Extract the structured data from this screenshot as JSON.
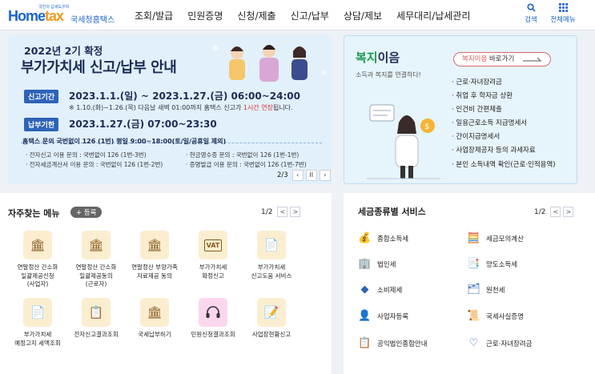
{
  "header": {
    "logo_small": "국민의 납세도우미",
    "logo_brand_a": "Home",
    "logo_brand_b": "tax",
    "logo_sub": "국세청홈택스",
    "nav": [
      "조회/발급",
      "민원증명",
      "신청/제출",
      "신고/납부",
      "상담/제보",
      "세무대리/납세관리"
    ],
    "search_label": "검색",
    "menu_label": "전체메뉴"
  },
  "banner": {
    "title1": "2022년 2기 확정",
    "title2": "부가가치세 신고/납부 안내",
    "period_pill": "신고기간",
    "period": "2023.1.1.(일) ~ 2023.1.27.(금) 06:00~24:00",
    "note_a": "※ 1.10.(화)~1.26.(목) 다음날 새벽 01:00까지 홈택스 신고가 ",
    "note_red": "1시간 연장",
    "note_b": "됩니다.",
    "deadline_pill": "납부기한",
    "deadline": "2023.1.27.(금) 07:00~23:30",
    "contact_main": "홈택스 문의 국번없이 126 (1번)  평일 9:00~18:00(토/일/공휴일 제외)",
    "contact_1": "· 전자신고 이용 문의 : 국번없이 126 (1번-3번)",
    "contact_2": "· 현금영수증 문의 : 국번없이 126 (1번-1번)",
    "contact_3": "· 전자세금계산서 이용 문의 : 국번없이 126 (1번-2번)",
    "contact_4": "· 증명발급 이용 문의 : 국번없이 126 (1번-7번)",
    "page": "2/3",
    "prev": "‹",
    "pause": "II",
    "next": "›"
  },
  "welfare": {
    "title_a": "복지",
    "title_b": "이음",
    "subtitle": "소득과 복지를 연결하다!",
    "button_red": "복지이음",
    "button_text": " 바로가기",
    "items": [
      "근로·자녀장려금",
      "취업 후 학자금 상환",
      "인건비 간편제출",
      "일용근로소득 지급명세서",
      "간이지급명세서",
      "사업장제공자 등의 과세자료",
      "본인 소득내역 확인(근로·인적용역)"
    ]
  },
  "favorites": {
    "title": "자주찾는 메뉴",
    "add": "+ 등록",
    "page": "1/2",
    "prev": "<",
    "next": ">",
    "tiles": [
      {
        "label": "연말정산 간소화\n일괄제공신청\n(사업자)",
        "icon": "building-icon"
      },
      {
        "label": "연말정산 간소화\n일괄제공동의\n(근로자)",
        "icon": "building-icon"
      },
      {
        "label": "연말정산 부양가족\n자료제공 동의",
        "icon": "building-icon"
      },
      {
        "label": "부가가치세\n확정신고",
        "icon": "vat-icon"
      },
      {
        "label": "부가가치세\n신고도움 서비스",
        "icon": "document-icon"
      },
      {
        "label": "부가가치세\n예정고지 세액조회",
        "icon": "document-icon"
      },
      {
        "label": "전자신고결과조회",
        "icon": "document-search-icon"
      },
      {
        "label": "국세납부하기",
        "icon": "building-icon"
      },
      {
        "label": "민원신청결과조회",
        "icon": "headset-icon"
      },
      {
        "label": "사업장현황신고",
        "icon": "edit-icon"
      }
    ]
  },
  "tax_services": {
    "title": "세금종류별 서비스",
    "page": "1/2",
    "prev": "<",
    "next": ">",
    "items": [
      {
        "label": "종합소득세",
        "icon": "income-tax-icon"
      },
      {
        "label": "세금모의계산",
        "icon": "calculator-icon"
      },
      {
        "label": "법인세",
        "icon": "corporation-icon"
      },
      {
        "label": "양도소득세",
        "icon": "transfer-icon"
      },
      {
        "label": "소비제세",
        "icon": "diamond-icon"
      },
      {
        "label": "원천세",
        "icon": "withholding-icon"
      },
      {
        "label": "사업자등록",
        "icon": "person-icon"
      },
      {
        "label": "국세사실증명",
        "icon": "certificate-icon"
      },
      {
        "label": "공익법인종합안내",
        "icon": "checklist-icon"
      },
      {
        "label": "근로·자녀장려금",
        "icon": "heart-icon"
      }
    ]
  }
}
